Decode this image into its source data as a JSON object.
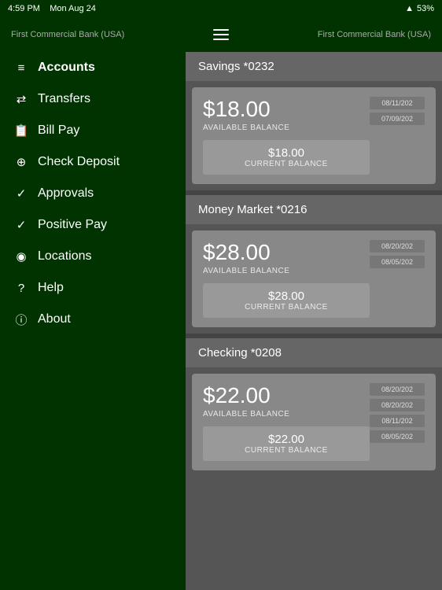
{
  "status_bar": {
    "time": "4:59 PM",
    "day_date": "Mon Aug 24",
    "wifi_icon": "wifi",
    "signal": "53%",
    "battery_label": "53%"
  },
  "header": {
    "bank_name_left": "First Commercial Bank (USA)",
    "bank_name_right": "First Commercial Bank (USA)",
    "hamburger_label": "Menu"
  },
  "sidebar": {
    "items": [
      {
        "id": "accounts",
        "label": "Accounts",
        "icon": "☰"
      },
      {
        "id": "transfers",
        "label": "Transfers",
        "icon": "⇄"
      },
      {
        "id": "bill-pay",
        "label": "Bill Pay",
        "icon": "📅"
      },
      {
        "id": "check-deposit",
        "label": "Check Deposit",
        "icon": "📷"
      },
      {
        "id": "approvals",
        "label": "Approvals",
        "icon": "✔"
      },
      {
        "id": "positive-pay",
        "label": "Positive Pay",
        "icon": "✔"
      },
      {
        "id": "locations",
        "label": "Locations",
        "icon": "📍"
      },
      {
        "id": "help",
        "label": "Help",
        "icon": "?"
      },
      {
        "id": "about",
        "label": "About",
        "icon": "ℹ"
      }
    ]
  },
  "accounts": [
    {
      "id": "savings",
      "title": "Savings *0232",
      "available_balance": "$18.00",
      "available_label": "AVAILABLE BALANCE",
      "current_balance": "$18.00",
      "current_label": "CURRENT BALANCE",
      "dates": [
        "08/11/202",
        "07/09/202"
      ]
    },
    {
      "id": "money-market",
      "title": "Money Market *0216",
      "available_balance": "$28.00",
      "available_label": "AVAILABLE BALANCE",
      "current_balance": "$28.00",
      "current_label": "CURRENT BALANCE",
      "dates": [
        "08/20/202",
        "08/05/202"
      ]
    },
    {
      "id": "checking",
      "title": "Checking *0208",
      "available_balance": "$22.00",
      "available_label": "AVAILABLE BALANCE",
      "current_balance": "$22.00",
      "current_label": "CURRENT BALANCE",
      "dates": [
        "08/20/202",
        "08/20/202",
        "08/11/202",
        "08/05/202"
      ]
    }
  ]
}
